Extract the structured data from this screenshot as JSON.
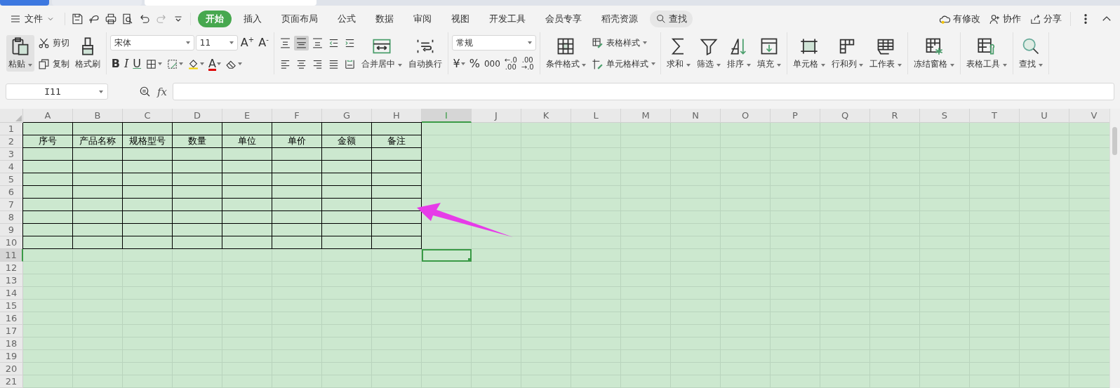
{
  "window_tabs": [
    {
      "kind": "home",
      "selected": false
    },
    {
      "kind": "document",
      "selected": false
    },
    {
      "kind": "document",
      "selected": true
    }
  ],
  "menu_bar": {
    "file_menu": "文件",
    "quick_access": [
      {
        "disabled": false
      },
      {
        "disabled": false
      },
      {
        "disabled": false
      },
      {
        "disabled": false
      },
      {
        "disabled": false
      },
      {
        "disabled": true
      },
      {
        "disabled": false
      }
    ],
    "tabs": [
      {
        "label": "开始",
        "selected": true
      },
      {
        "label": "插入",
        "selected": false
      },
      {
        "label": "页面布局",
        "selected": false
      },
      {
        "label": "公式",
        "selected": false
      },
      {
        "label": "数据",
        "selected": false
      },
      {
        "label": "审阅",
        "selected": false
      },
      {
        "label": "视图",
        "selected": false
      },
      {
        "label": "开发工具",
        "selected": false
      },
      {
        "label": "会员专享",
        "selected": false
      },
      {
        "label": "稻壳资源",
        "selected": false
      }
    ],
    "search": "查找",
    "actions": [
      "有修改",
      "协作",
      "分享"
    ]
  },
  "ribbon": {
    "groups": [
      {
        "columns": [
          {
            "lines": [
              {
                "items": [
                  {
                    "kind": "large",
                    "label": "粘贴",
                    "dropdown": true,
                    "hover": true
                  }
                ]
              }
            ]
          },
          {
            "lines": [
              {
                "items": [
                  {
                    "kind": "small",
                    "label": "剪切",
                    "dropdown": false
                  }
                ]
              },
              {
                "items": [
                  {
                    "kind": "small",
                    "label": "复制",
                    "dropdown": false
                  }
                ]
              }
            ]
          },
          {
            "lines": [
              {
                "items": [
                  {
                    "kind": "large",
                    "label": "格式刷",
                    "dropdown": false
                  }
                ]
              }
            ]
          }
        ]
      },
      {
        "columns": [
          {
            "lines": [
              {
                "items": [
                  {
                    "kind": "select",
                    "value": "宋体"
                  },
                  {
                    "kind": "select",
                    "value": "11"
                  },
                  {
                    "kind": "glyph",
                    "label": "A$^{+}$",
                    "dropdown": false
                  },
                  {
                    "kind": "glyph",
                    "label": "A$^{-}$",
                    "dropdown": false
                  }
                ]
              },
              {
                "items": [
                  {
                    "kind": "glyph",
                    "label": "B",
                    "dropdown": false
                  },
                  {
                    "kind": "glyph",
                    "label": "I",
                    "dropdown": false
                  },
                  {
                    "kind": "glyph",
                    "label": "U",
                    "dropdown": false
                  },
                  {
                    "kind": "icon",
                    "dropdown": true,
                    "selected": false
                  },
                  {
                    "kind": "icon",
                    "dropdown": true,
                    "selected": false
                  },
                  {
                    "kind": "icon",
                    "dropdown": true,
                    "selected": false
                  },
                  {
                    "kind": "glyph",
                    "label": "A",
                    "dropdown": true
                  },
                  {
                    "kind": "icon",
                    "dropdown": true,
                    "selected": false
                  }
                ]
              }
            ]
          }
        ]
      },
      {
        "columns": [
          {
            "lines": [
              {
                "items": [
                  {
                    "kind": "icon",
                    "dropdown": false,
                    "selected": false
                  },
                  {
                    "kind": "icon",
                    "dropdown": false,
                    "selected": true
                  },
                  {
                    "kind": "icon",
                    "dropdown": false,
                    "selected": false
                  },
                  {
                    "kind": "icon",
                    "dropdown": false,
                    "selected": false
                  },
                  {
                    "kind": "icon",
                    "dropdown": false,
                    "selected": false
                  }
                ]
              },
              {
                "items": [
                  {
                    "kind": "icon",
                    "dropdown": false,
                    "selected": false
                  },
                  {
                    "kind": "icon",
                    "dropdown": false,
                    "selected": false
                  },
                  {
                    "kind": "icon",
                    "dropdown": false,
                    "selected": false
                  },
                  {
                    "kind": "icon",
                    "dropdown": false,
                    "selected": false
                  },
                  {
                    "kind": "icon",
                    "dropdown": false,
                    "selected": false
                  }
                ]
              }
            ]
          },
          {
            "lines": [
              {
                "items": [
                  {
                    "kind": "large",
                    "label": "合并居中",
                    "dropdown": true
                  }
                ]
              }
            ]
          },
          {
            "lines": [
              {
                "items": [
                  {
                    "kind": "large",
                    "label": "自动换行",
                    "dropdown": false
                  }
                ]
              }
            ]
          }
        ]
      },
      {
        "columns": [
          {
            "lines": [
              {
                "items": [
                  {
                    "kind": "select",
                    "value": "常规"
                  }
                ]
              },
              {
                "items": [
                  {
                    "kind": "glyph",
                    "label": "¥",
                    "dropdown": true
                  },
                  {
                    "kind": "glyph",
                    "label": "%",
                    "dropdown": false
                  },
                  {
                    "kind": "glyph",
                    "label": "000",
                    "dropdown": false
                  },
                  {
                    "kind": "glyph",
                    "label": "←.0\n.00",
                    "dropdown": false
                  },
                  {
                    "kind": "glyph",
                    "label": ".00\n→.0",
                    "dropdown": false
                  }
                ]
              }
            ]
          }
        ]
      },
      {
        "columns": [
          {
            "lines": [
              {
                "items": [
                  {
                    "kind": "large",
                    "label": "条件格式",
                    "dropdown": true
                  }
                ]
              }
            ]
          },
          {
            "lines": [
              {
                "items": [
                  {
                    "kind": "small",
                    "label": "表格样式",
                    "dropdown": true
                  }
                ]
              },
              {
                "items": [
                  {
                    "kind": "small",
                    "label": "单元格样式",
                    "dropdown": true
                  }
                ]
              }
            ]
          }
        ]
      },
      {
        "columns": [
          {
            "lines": [
              {
                "items": [
                  {
                    "kind": "large",
                    "label": "求和",
                    "dropdown": true
                  }
                ]
              }
            ]
          },
          {
            "lines": [
              {
                "items": [
                  {
                    "kind": "large",
                    "label": "筛选",
                    "dropdown": true
                  }
                ]
              }
            ]
          },
          {
            "lines": [
              {
                "items": [
                  {
                    "kind": "large",
                    "label": "排序",
                    "dropdown": true
                  }
                ]
              }
            ]
          },
          {
            "lines": [
              {
                "items": [
                  {
                    "kind": "large",
                    "label": "填充",
                    "dropdown": true
                  }
                ]
              }
            ]
          }
        ]
      },
      {
        "columns": [
          {
            "lines": [
              {
                "items": [
                  {
                    "kind": "large",
                    "label": "单元格",
                    "dropdown": true
                  }
                ]
              }
            ]
          },
          {
            "lines": [
              {
                "items": [
                  {
                    "kind": "large",
                    "label": "行和列",
                    "dropdown": true
                  }
                ]
              }
            ]
          },
          {
            "lines": [
              {
                "items": [
                  {
                    "kind": "large",
                    "label": "工作表",
                    "dropdown": true
                  }
                ]
              }
            ]
          }
        ]
      },
      {
        "columns": [
          {
            "lines": [
              {
                "items": [
                  {
                    "kind": "large",
                    "label": "冻结窗格",
                    "dropdown": true
                  }
                ]
              }
            ]
          }
        ]
      },
      {
        "columns": [
          {
            "lines": [
              {
                "items": [
                  {
                    "kind": "large",
                    "label": "表格工具",
                    "dropdown": true
                  }
                ]
              }
            ]
          }
        ]
      },
      {
        "columns": [
          {
            "lines": [
              {
                "items": [
                  {
                    "kind": "large",
                    "label": "查找",
                    "dropdown": true
                  }
                ]
              }
            ]
          }
        ]
      }
    ]
  },
  "formula_bar": {
    "name_box": "I11",
    "function_label": "fx"
  },
  "sheet": {
    "columns": [
      {
        "label": "A",
        "selected": false,
        "bordered": true
      },
      {
        "label": "B",
        "selected": false,
        "bordered": true
      },
      {
        "label": "C",
        "selected": false,
        "bordered": true
      },
      {
        "label": "D",
        "selected": false,
        "bordered": true
      },
      {
        "label": "E",
        "selected": false,
        "bordered": true
      },
      {
        "label": "F",
        "selected": false,
        "bordered": true
      },
      {
        "label": "G",
        "selected": false,
        "bordered": true
      },
      {
        "label": "H",
        "selected": false,
        "bordered": true
      },
      {
        "label": "I",
        "selected": true,
        "bordered": false
      },
      {
        "label": "J",
        "selected": false,
        "bordered": false
      },
      {
        "label": "K",
        "selected": false,
        "bordered": false
      },
      {
        "label": "L",
        "selected": false,
        "bordered": false
      },
      {
        "label": "M",
        "selected": false,
        "bordered": false
      },
      {
        "label": "N",
        "selected": false,
        "bordered": false
      },
      {
        "label": "O",
        "selected": false,
        "bordered": false
      },
      {
        "label": "P",
        "selected": false,
        "bordered": false
      },
      {
        "label": "Q",
        "selected": false,
        "bordered": false
      },
      {
        "label": "R",
        "selected": false,
        "bordered": false
      },
      {
        "label": "S",
        "selected": false,
        "bordered": false
      },
      {
        "label": "T",
        "selected": false,
        "bordered": false
      },
      {
        "label": "U",
        "selected": false,
        "bordered": false
      },
      {
        "label": "V",
        "selected": false,
        "bordered": false
      }
    ],
    "rows": [
      {
        "label": "1",
        "selected": false,
        "bordered": true
      },
      {
        "label": "2",
        "selected": false,
        "bordered": true,
        "cells": [
          "序号",
          "产品名称",
          "规格型号",
          "数量",
          "单位",
          "单价",
          "金额",
          "备注"
        ]
      },
      {
        "label": "3",
        "selected": false,
        "bordered": true
      },
      {
        "label": "4",
        "selected": false,
        "bordered": true
      },
      {
        "label": "5",
        "selected": false,
        "bordered": true
      },
      {
        "label": "6",
        "selected": false,
        "bordered": true
      },
      {
        "label": "7",
        "selected": false,
        "bordered": true
      },
      {
        "label": "8",
        "selected": false,
        "bordered": true
      },
      {
        "label": "9",
        "selected": false,
        "bordered": true
      },
      {
        "label": "10",
        "selected": false,
        "bordered": true
      },
      {
        "label": "11",
        "selected": true,
        "bordered": false
      },
      {
        "label": "12",
        "selected": false,
        "bordered": false
      },
      {
        "label": "13",
        "selected": false,
        "bordered": false
      },
      {
        "label": "14",
        "selected": false,
        "bordered": false
      },
      {
        "label": "15",
        "selected": false,
        "bordered": false
      },
      {
        "label": "16",
        "selected": false,
        "bordered": false
      },
      {
        "label": "17",
        "selected": false,
        "bordered": false
      },
      {
        "label": "18",
        "selected": false,
        "bordered": false
      },
      {
        "label": "19",
        "selected": false,
        "bordered": false
      },
      {
        "label": "20",
        "selected": false,
        "bordered": false
      },
      {
        "label": "21",
        "selected": false,
        "bordered": false
      }
    ]
  },
  "annotations": [
    {
      "kind": "arrow"
    }
  ]
}
